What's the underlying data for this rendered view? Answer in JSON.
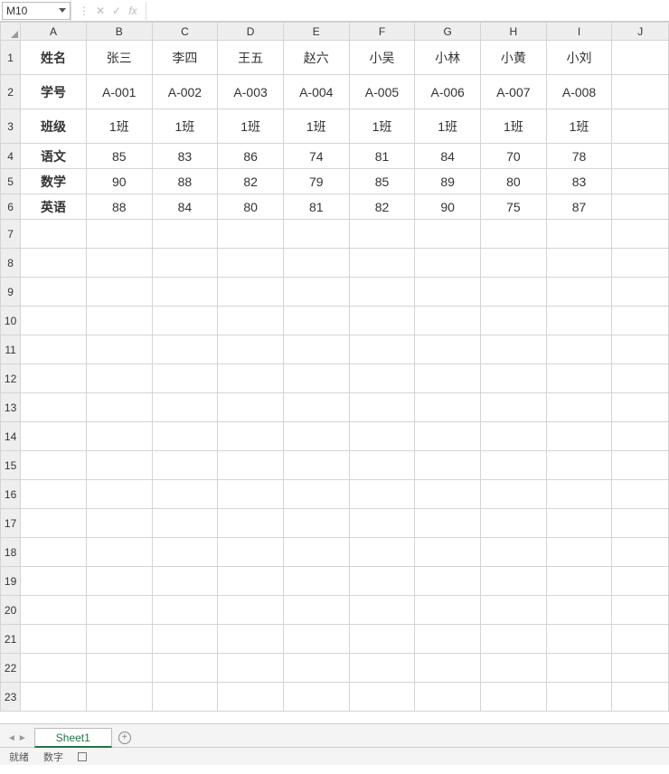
{
  "namebox": {
    "value": "M10"
  },
  "column_letters": [
    "A",
    "B",
    "C",
    "D",
    "E",
    "F",
    "G",
    "H",
    "I",
    "J"
  ],
  "row_labels": {
    "r1": "姓名",
    "r2": "学号",
    "r3": "班级",
    "r4": "语文",
    "r5": "数学",
    "r6": "英语"
  },
  "students": [
    {
      "name": "张三",
      "id": "A-001",
      "class": "1班",
      "chinese": "85",
      "math": "90",
      "english": "88"
    },
    {
      "name": "李四",
      "id": "A-002",
      "class": "1班",
      "chinese": "83",
      "math": "88",
      "english": "84"
    },
    {
      "name": "王五",
      "id": "A-003",
      "class": "1班",
      "chinese": "86",
      "math": "82",
      "english": "80"
    },
    {
      "name": "赵六",
      "id": "A-004",
      "class": "1班",
      "chinese": "74",
      "math": "79",
      "english": "81"
    },
    {
      "name": "小吴",
      "id": "A-005",
      "class": "1班",
      "chinese": "81",
      "math": "85",
      "english": "82"
    },
    {
      "name": "小林",
      "id": "A-006",
      "class": "1班",
      "chinese": "84",
      "math": "89",
      "english": "90"
    },
    {
      "name": "小黄",
      "id": "A-007",
      "class": "1班",
      "chinese": "70",
      "math": "80",
      "english": "75"
    },
    {
      "name": "小刘",
      "id": "A-008",
      "class": "1班",
      "chinese": "78",
      "math": "83",
      "english": "87"
    }
  ],
  "blank_rows": 17,
  "sheet_tab": "Sheet1",
  "status": {
    "ready": "就绪",
    "mode": "数字"
  },
  "nav": {
    "prev": "◄",
    "next": "►"
  },
  "add": "+",
  "fx_btns": {
    "dots": "⋮",
    "cancel": "✕",
    "enter": "✓",
    "fx": "fx"
  }
}
